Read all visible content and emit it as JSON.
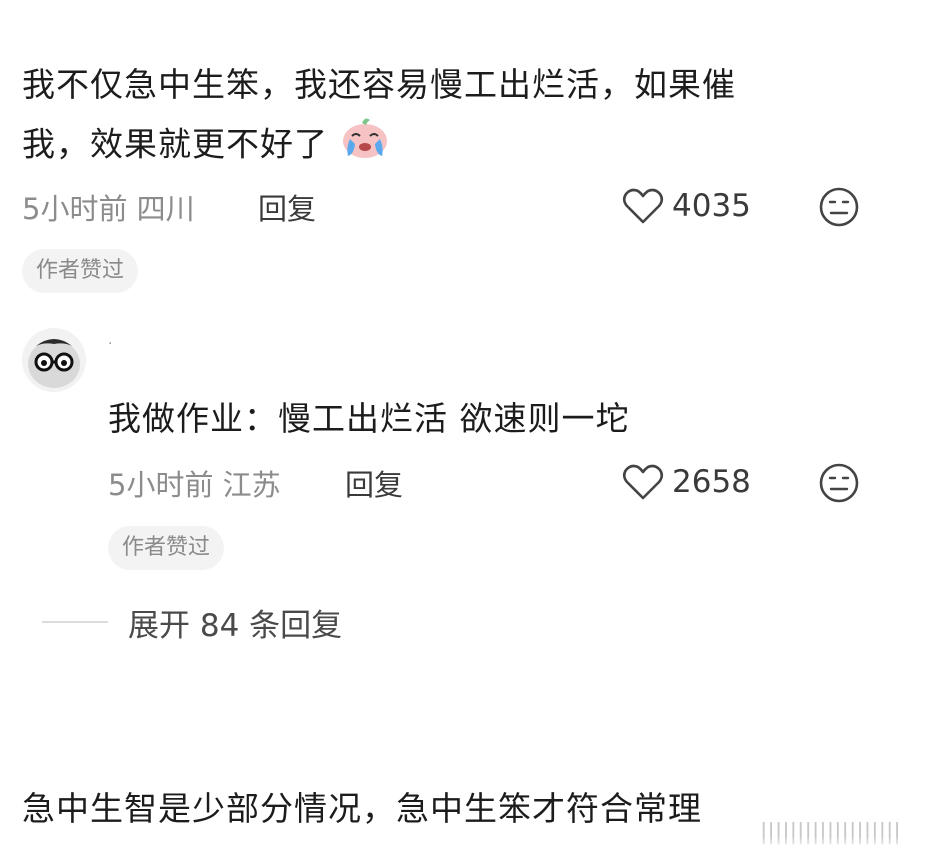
{
  "comment1": {
    "text_line1": "我不仅急中生笨，我还容易慢工出烂活，如果催",
    "text_line2": "我，效果就更不好了",
    "emoji": "crying-face-emoji",
    "time": "5小时前",
    "location": "四川",
    "reply_label": "回复",
    "likes": "4035",
    "author_badge": "作者赞过"
  },
  "comment2": {
    "username": "·",
    "text": "我做作业：慢工出烂活 欲速则一坨",
    "time": "5小时前",
    "location": "江苏",
    "reply_label": "回复",
    "likes": "2658",
    "author_badge": "作者赞过"
  },
  "expand": {
    "label": "展开 84 条回复"
  },
  "comment3": {
    "text": "急中生智是少部分情况，急中生笨才符合常理",
    "watermark": "|||||||||||||||||||"
  },
  "colors": {
    "text": "#1c1c1c",
    "meta": "#8c8c8c",
    "badge_bg": "#f3f3f3"
  }
}
